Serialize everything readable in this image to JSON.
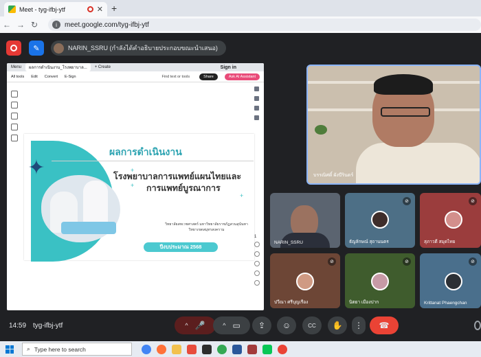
{
  "browser": {
    "tab_title": "Meet - tyg-ifbj-ytf",
    "tab_close": "✕",
    "new_tab": "+",
    "url": "meet.google.com/tyg-ifbj-ytf",
    "nav": {
      "back": "←",
      "forward": "→",
      "reload": "↻"
    }
  },
  "meet": {
    "presenter_label": "NARIN_SSRU (กำลังได้คำอธิบายประกอบขณะนำเสนอ)",
    "time": "14:59",
    "meeting_code": "tyg-ifbj-ytf"
  },
  "shared_screen": {
    "tabs": [
      "Menu",
      "ผลการดำเนินงาน_โรงพยาบาล...",
      "+ Create"
    ],
    "sign_in": "Sign in",
    "menu": [
      "All tools",
      "Edit",
      "Convert",
      "E-Sign"
    ],
    "find": "Find text or tools",
    "share_btn": "Share",
    "ai_btn": "Ask AI Assistant",
    "page_num": "1",
    "slide": {
      "title": "ผลการดำเนินงาน",
      "subtitle_line1": "โรงพยาบาลการแพทย์แผนไทยและ",
      "subtitle_line2": "การแพทย์บูรณาการ",
      "faculty_line1": "วิทยาลัยสหเวชศาสตร์ มหาวิทยาลัยราชภัฏสวนสุนันทา",
      "faculty_line2": "วิทยาเขตสมุทรสงคราม",
      "year": "ปีงบประมาณ 2568"
    }
  },
  "participants": [
    {
      "name": "บรรณิศดิ์ ผังบีรินดร์",
      "muted": false,
      "role": "speaker"
    },
    {
      "name": "NARIN_SSRU",
      "muted": false
    },
    {
      "name": "ธัญลักษณ์ สุถานนตร",
      "muted": true
    },
    {
      "name": "สุภาวดี สมุดไทย",
      "muted": true
    },
    {
      "name": "ปวีณา ศรีบุญเรือง",
      "muted": true
    },
    {
      "name": "นิตยา เมืองปาก",
      "muted": true
    },
    {
      "name": "Krittanat Phaengchan",
      "muted": true
    }
  ],
  "controls": {
    "mic_muted": "🎤",
    "more_up": "^",
    "camera": "▭",
    "present": "⇪",
    "emoji": "☺",
    "captions": "CC",
    "raise_hand": "✋",
    "more": "⋮",
    "end": "☎"
  },
  "taskbar": {
    "search_placeholder": "Type here to search"
  },
  "colors": {
    "meet_bg": "#202124",
    "end_call": "#ea4335",
    "accent_blue": "#1a73e8",
    "slide_teal": "#3ac1c4"
  }
}
